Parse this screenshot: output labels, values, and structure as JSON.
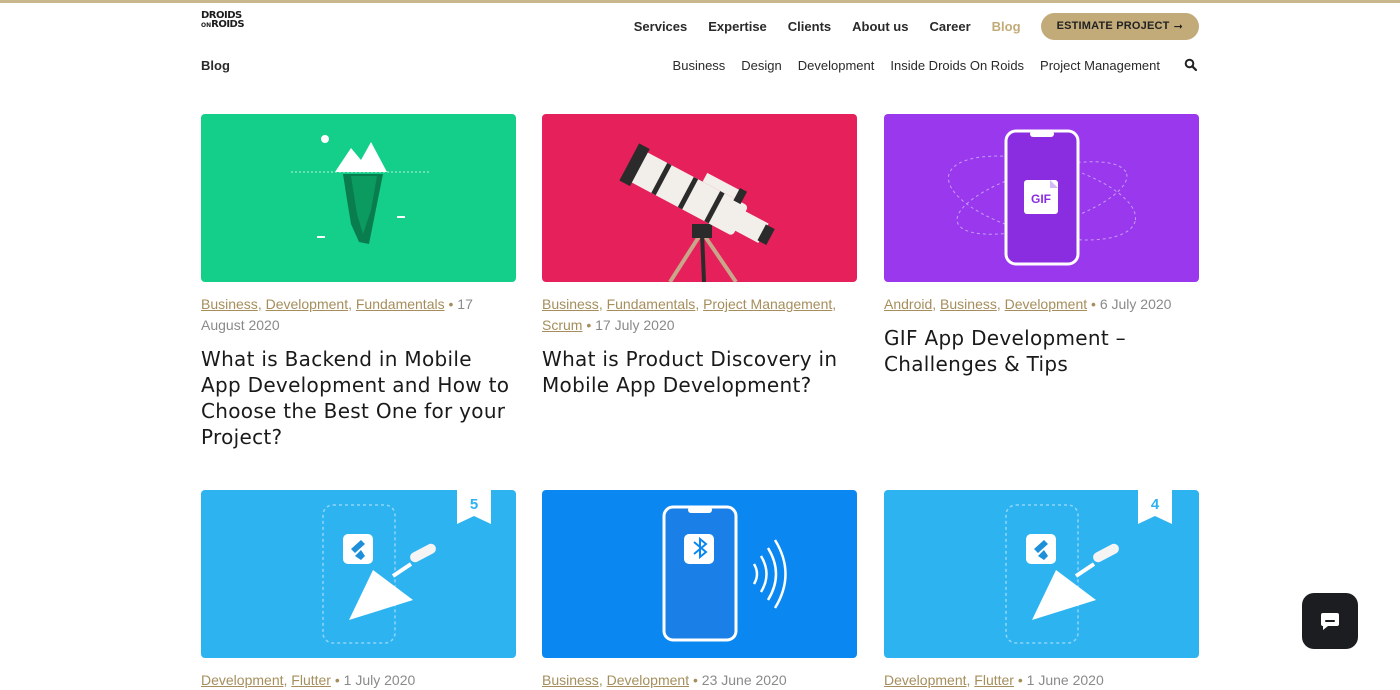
{
  "header": {
    "logo_line1": "DROIDS",
    "logo_on": "ON",
    "logo_line2": "ROIDS",
    "nav": [
      "Services",
      "Expertise",
      "Clients",
      "About us",
      "Career",
      "Blog"
    ],
    "active_nav": "Blog",
    "cta_label": "ESTIMATE PROJECT",
    "cta_arrow": "➞"
  },
  "subbar": {
    "title": "Blog",
    "categories": [
      "Business",
      "Design",
      "Development",
      "Inside Droids On Roids",
      "Project Management"
    ],
    "search_icon": "search-icon"
  },
  "posts": [
    {
      "tags": [
        "Business",
        "Development",
        "Fundamentals"
      ],
      "date": "17 August 2020",
      "title": "What is Backend in Mobile App Development and How to Choose the Best One for your Project?",
      "bg": "#13cf8a"
    },
    {
      "tags": [
        "Business",
        "Fundamentals",
        "Project Management",
        "Scrum"
      ],
      "date": "17 July 2020",
      "title": "What is Product Discovery in Mobile App Development?",
      "bg": "#e5205a"
    },
    {
      "tags": [
        "Android",
        "Business",
        "Development"
      ],
      "date": "6 July 2020",
      "title": "GIF App Development – Challenges & Tips",
      "bg": "#9a38ee",
      "badge": "GIF"
    },
    {
      "tags": [
        "Development",
        "Flutter"
      ],
      "date": "1 July 2020",
      "title": "",
      "bg": "#2eb3f1",
      "ribbon": "5"
    },
    {
      "tags": [
        "Business",
        "Development"
      ],
      "date": "23 June 2020",
      "title": "",
      "bg": "#0a87f0"
    },
    {
      "tags": [
        "Development",
        "Flutter"
      ],
      "date": "1 June 2020",
      "title": "",
      "bg": "#2eb3f1",
      "ribbon": "4"
    }
  ],
  "colors": {
    "accent": "#c2ab78",
    "tag_link": "#a58e5c",
    "chat_button": "#1b1d20"
  },
  "chat": {
    "icon": "chat-bubble-icon"
  }
}
